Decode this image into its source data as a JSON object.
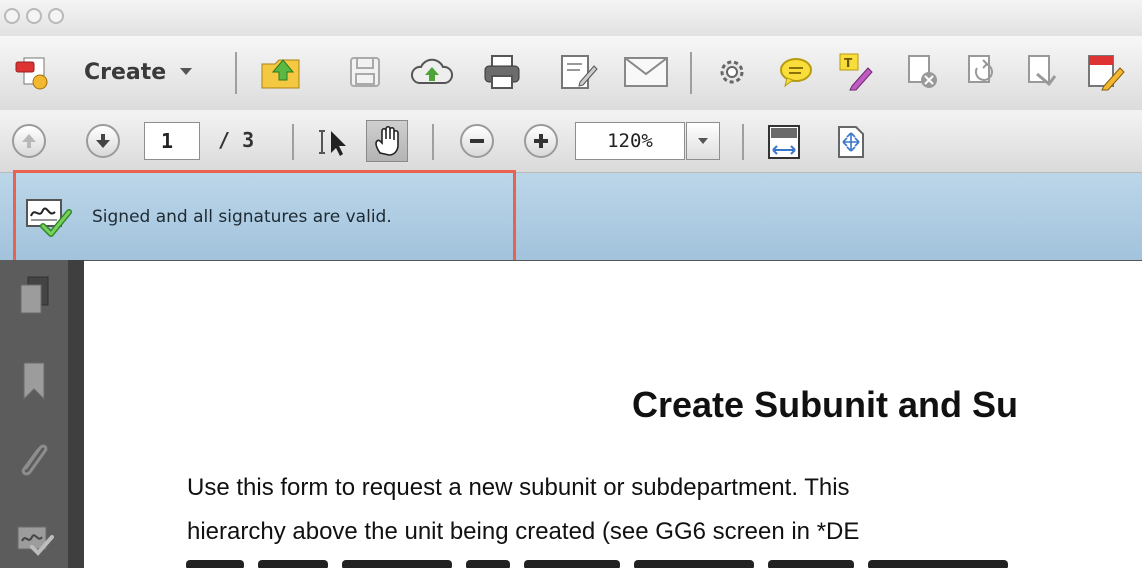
{
  "toolbar": {
    "create_label": "Create",
    "icons": [
      "create-pdf-icon",
      "open-folder-icon",
      "save-icon",
      "upload-cloud-icon",
      "print-icon",
      "edit-document-icon",
      "email-icon",
      "settings-gear-icon",
      "comment-icon",
      "highlight-icon",
      "delete-page-icon",
      "replace-page-icon",
      "extract-page-icon",
      "sign-icon"
    ]
  },
  "navigation": {
    "current_page": "1",
    "page_total": "/ 3",
    "zoom": "120%"
  },
  "signature_bar": {
    "message": "Signed and all signatures are valid."
  },
  "sidebar": {
    "icons": [
      "pages-icon",
      "bookmark-icon",
      "attachment-icon",
      "signature-panel-icon"
    ]
  },
  "document": {
    "title": "Create Subunit and Su",
    "lines": [
      "Use this form to request a new subunit or subdepartment. This",
      "hierarchy above the unit being created (see GG6 screen in *DE"
    ]
  },
  "colors": {
    "signature_bar": "#aecbe2",
    "highlight_border": "#e8624f",
    "sidebar": "#5c5c5c"
  }
}
